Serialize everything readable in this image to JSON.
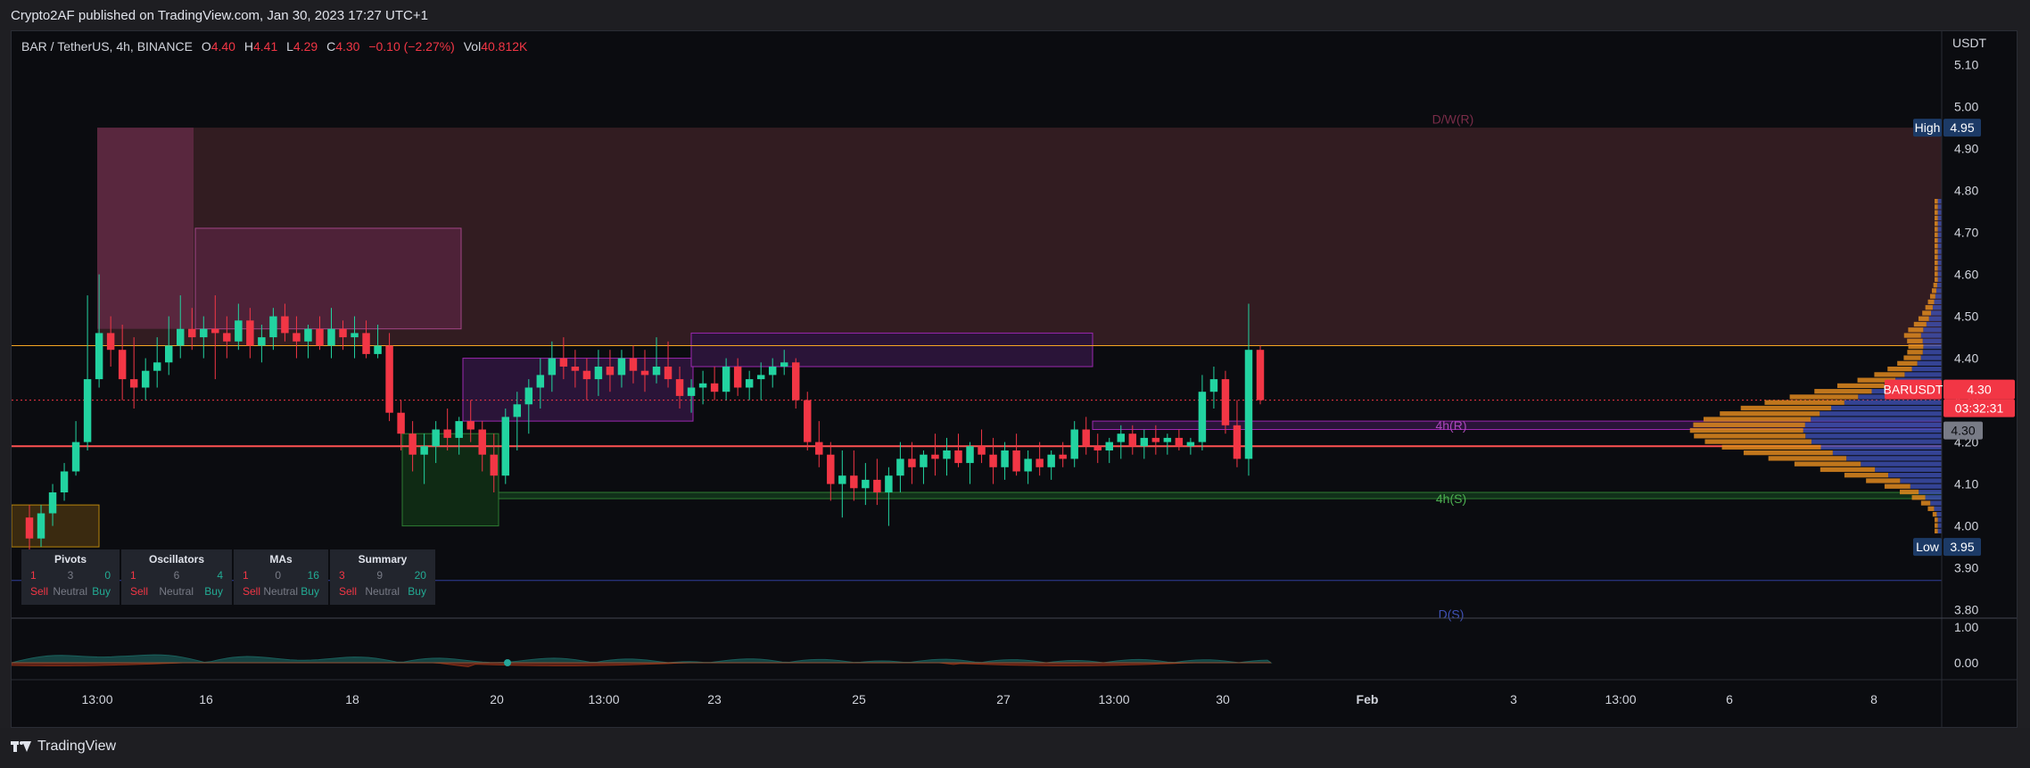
{
  "header": {
    "text": "Crypto2AF published on TradingView.com, Jan 30, 2023 17:27 UTC+1"
  },
  "legend": {
    "symbol": "BAR / TetherUS, 4h, BINANCE",
    "open_label": "O",
    "open": "4.40",
    "high_label": "H",
    "high": "4.41",
    "low_label": "L",
    "low": "4.29",
    "close_label": "C",
    "close": "4.30",
    "change": "−0.10 (−2.27%)",
    "vol_label": "Vol",
    "vol": "40.812K"
  },
  "colors": {
    "bull": "#22d3a0",
    "bear": "#f23645",
    "background": "#0b0c10",
    "resistance_zone": "#3a2024",
    "support_line": "#2e7d32",
    "pivot_line": "#ff5252",
    "profile_blue": "#3f51b5",
    "profile_orange": "#e08a1e"
  },
  "chart_data": {
    "type": "candlestick",
    "interval": "4h",
    "price_axis": {
      "unit": "USDT",
      "ticks": [
        "5.10",
        "5.00",
        "4.90",
        "4.80",
        "4.70",
        "4.60",
        "4.50",
        "4.40",
        "4.30",
        "4.20",
        "4.10",
        "4.00",
        "3.90",
        "3.80"
      ],
      "range": [
        3.78,
        5.18
      ]
    },
    "time_axis": {
      "ticks": [
        "13:00",
        "16",
        "18",
        "20",
        "13:00",
        "23",
        "25",
        "27",
        "13:00",
        "30",
        "Feb",
        "3",
        "13:00",
        "6",
        "8"
      ]
    },
    "badges": {
      "high_label": "High",
      "high_value": "4.95",
      "low_label": "Low",
      "low_value": "3.95",
      "symbol_label": "BARUSDT",
      "last_price": "4.30",
      "countdown": "03:32:31",
      "marker_price": "4.30"
    },
    "annotations": [
      {
        "text": "D/W(R)",
        "price": 4.97
      },
      {
        "text": "4h(R)",
        "price": 4.24
      },
      {
        "text": "4h(S)",
        "price": 4.065
      },
      {
        "text": "D(S)",
        "price": 3.79
      }
    ],
    "levels": [
      {
        "name": "pivot",
        "price": 4.19
      },
      {
        "name": "resistance_top",
        "price": 4.95
      },
      {
        "name": "resistance_bottom",
        "price": 4.43
      },
      {
        "name": "support_4h",
        "price": 4.08
      },
      {
        "name": "daily_support",
        "price": 3.87
      },
      {
        "name": "dotted_last",
        "price": 4.3
      }
    ],
    "oscillator_ticks": [
      "1.00",
      "0.00"
    ],
    "candles": [
      [
        4.02,
        4.05,
        3.93,
        3.97
      ],
      [
        3.97,
        4.05,
        3.95,
        4.03
      ],
      [
        4.03,
        4.1,
        4.0,
        4.08
      ],
      [
        4.08,
        4.15,
        4.06,
        4.13
      ],
      [
        4.13,
        4.25,
        4.12,
        4.2
      ],
      [
        4.2,
        4.55,
        4.18,
        4.35
      ],
      [
        4.35,
        4.6,
        4.33,
        4.46
      ],
      [
        4.46,
        4.5,
        4.38,
        4.42
      ],
      [
        4.42,
        4.48,
        4.3,
        4.35
      ],
      [
        4.35,
        4.45,
        4.28,
        4.33
      ],
      [
        4.33,
        4.4,
        4.3,
        4.37
      ],
      [
        4.37,
        4.45,
        4.33,
        4.39
      ],
      [
        4.39,
        4.5,
        4.36,
        4.43
      ],
      [
        4.43,
        4.55,
        4.4,
        4.47
      ],
      [
        4.47,
        4.52,
        4.42,
        4.45
      ],
      [
        4.45,
        4.5,
        4.4,
        4.47
      ],
      [
        4.47,
        4.55,
        4.35,
        4.46
      ],
      [
        4.46,
        4.5,
        4.4,
        4.44
      ],
      [
        4.44,
        4.53,
        4.42,
        4.49
      ],
      [
        4.49,
        4.52,
        4.4,
        4.43
      ],
      [
        4.43,
        4.48,
        4.39,
        4.45
      ],
      [
        4.45,
        4.52,
        4.42,
        4.5
      ],
      [
        4.5,
        4.53,
        4.44,
        4.46
      ],
      [
        4.46,
        4.5,
        4.4,
        4.44
      ],
      [
        4.44,
        4.48,
        4.4,
        4.47
      ],
      [
        4.47,
        4.5,
        4.42,
        4.43
      ],
      [
        4.43,
        4.52,
        4.4,
        4.47
      ],
      [
        4.47,
        4.49,
        4.42,
        4.45
      ],
      [
        4.45,
        4.5,
        4.4,
        4.46
      ],
      [
        4.46,
        4.49,
        4.4,
        4.41
      ],
      [
        4.41,
        4.48,
        4.4,
        4.43
      ],
      [
        4.43,
        4.46,
        4.25,
        4.27
      ],
      [
        4.27,
        4.3,
        4.18,
        4.22
      ],
      [
        4.22,
        4.25,
        4.13,
        4.17
      ],
      [
        4.17,
        4.22,
        4.1,
        4.19
      ],
      [
        4.19,
        4.25,
        4.15,
        4.23
      ],
      [
        4.23,
        4.28,
        4.18,
        4.21
      ],
      [
        4.21,
        4.26,
        4.17,
        4.25
      ],
      [
        4.25,
        4.3,
        4.2,
        4.23
      ],
      [
        4.23,
        4.25,
        4.13,
        4.17
      ],
      [
        4.17,
        4.22,
        4.08,
        4.12
      ],
      [
        4.12,
        4.28,
        4.1,
        4.26
      ],
      [
        4.26,
        4.32,
        4.18,
        4.29
      ],
      [
        4.29,
        4.35,
        4.22,
        4.33
      ],
      [
        4.33,
        4.4,
        4.28,
        4.36
      ],
      [
        4.36,
        4.44,
        4.32,
        4.4
      ],
      [
        4.4,
        4.45,
        4.35,
        4.38
      ],
      [
        4.38,
        4.42,
        4.33,
        4.37
      ],
      [
        4.37,
        4.4,
        4.3,
        4.35
      ],
      [
        4.35,
        4.42,
        4.31,
        4.38
      ],
      [
        4.38,
        4.42,
        4.32,
        4.36
      ],
      [
        4.36,
        4.42,
        4.33,
        4.4
      ],
      [
        4.4,
        4.43,
        4.34,
        4.37
      ],
      [
        4.37,
        4.42,
        4.32,
        4.36
      ],
      [
        4.36,
        4.45,
        4.34,
        4.38
      ],
      [
        4.38,
        4.44,
        4.33,
        4.35
      ],
      [
        4.35,
        4.38,
        4.28,
        4.31
      ],
      [
        4.31,
        4.35,
        4.27,
        4.33
      ],
      [
        4.33,
        4.37,
        4.29,
        4.34
      ],
      [
        4.34,
        4.38,
        4.3,
        4.32
      ],
      [
        4.32,
        4.4,
        4.3,
        4.38
      ],
      [
        4.38,
        4.4,
        4.31,
        4.33
      ],
      [
        4.33,
        4.37,
        4.3,
        4.35
      ],
      [
        4.35,
        4.39,
        4.3,
        4.36
      ],
      [
        4.36,
        4.4,
        4.33,
        4.38
      ],
      [
        4.38,
        4.42,
        4.36,
        4.39
      ],
      [
        4.39,
        4.4,
        4.28,
        4.3
      ],
      [
        4.3,
        4.32,
        4.18,
        4.2
      ],
      [
        4.2,
        4.25,
        4.14,
        4.17
      ],
      [
        4.17,
        4.2,
        4.06,
        4.1
      ],
      [
        4.1,
        4.18,
        4.02,
        4.12
      ],
      [
        4.12,
        4.18,
        4.06,
        4.09
      ],
      [
        4.09,
        4.15,
        4.05,
        4.11
      ],
      [
        4.11,
        4.16,
        4.05,
        4.08
      ],
      [
        4.08,
        4.14,
        4.0,
        4.12
      ],
      [
        4.12,
        4.2,
        4.08,
        4.16
      ],
      [
        4.16,
        4.2,
        4.1,
        4.14
      ],
      [
        4.14,
        4.18,
        4.1,
        4.17
      ],
      [
        4.17,
        4.22,
        4.12,
        4.16
      ],
      [
        4.16,
        4.21,
        4.12,
        4.18
      ],
      [
        4.18,
        4.22,
        4.14,
        4.15
      ],
      [
        4.15,
        4.2,
        4.1,
        4.19
      ],
      [
        4.19,
        4.23,
        4.15,
        4.17
      ],
      [
        4.17,
        4.21,
        4.1,
        4.14
      ],
      [
        4.14,
        4.2,
        4.11,
        4.18
      ],
      [
        4.18,
        4.22,
        4.12,
        4.13
      ],
      [
        4.13,
        4.18,
        4.1,
        4.16
      ],
      [
        4.16,
        4.2,
        4.12,
        4.14
      ],
      [
        4.14,
        4.18,
        4.11,
        4.17
      ],
      [
        4.17,
        4.2,
        4.14,
        4.16
      ],
      [
        4.16,
        4.25,
        4.14,
        4.23
      ],
      [
        4.23,
        4.26,
        4.17,
        4.19
      ],
      [
        4.19,
        4.22,
        4.15,
        4.18
      ],
      [
        4.18,
        4.21,
        4.15,
        4.2
      ],
      [
        4.2,
        4.24,
        4.16,
        4.22
      ],
      [
        4.22,
        4.24,
        4.17,
        4.19
      ],
      [
        4.19,
        4.23,
        4.16,
        4.21
      ],
      [
        4.21,
        4.24,
        4.17,
        4.2
      ],
      [
        4.2,
        4.22,
        4.17,
        4.21
      ],
      [
        4.21,
        4.23,
        4.18,
        4.19
      ],
      [
        4.19,
        4.21,
        4.17,
        4.2
      ],
      [
        4.2,
        4.36,
        4.18,
        4.32
      ],
      [
        4.32,
        4.38,
        4.28,
        4.35
      ],
      [
        4.35,
        4.37,
        4.22,
        4.24
      ],
      [
        4.24,
        4.3,
        4.14,
        4.16
      ],
      [
        4.16,
        4.53,
        4.12,
        4.42
      ],
      [
        4.42,
        4.43,
        4.29,
        4.3
      ]
    ]
  },
  "tech_panels": [
    {
      "title": "Pivots",
      "sell": "1",
      "neutral": "3",
      "buy": "0",
      "sell_label": "Sell",
      "neutral_label": "Neutral",
      "buy_label": "Buy"
    },
    {
      "title": "Oscillators",
      "sell": "1",
      "neutral": "6",
      "buy": "4",
      "sell_label": "Sell",
      "neutral_label": "Neutral",
      "buy_label": "Buy"
    },
    {
      "title": "MAs",
      "sell": "1",
      "neutral": "0",
      "buy": "16",
      "sell_label": "Sell",
      "neutral_label": "Neutral",
      "buy_label": "Buy"
    },
    {
      "title": "Summary",
      "sell": "3",
      "neutral": "9",
      "buy": "20",
      "sell_label": "Sell",
      "neutral_label": "Neutral",
      "buy_label": "Buy"
    }
  ],
  "footer": {
    "brand": "TradingView"
  }
}
